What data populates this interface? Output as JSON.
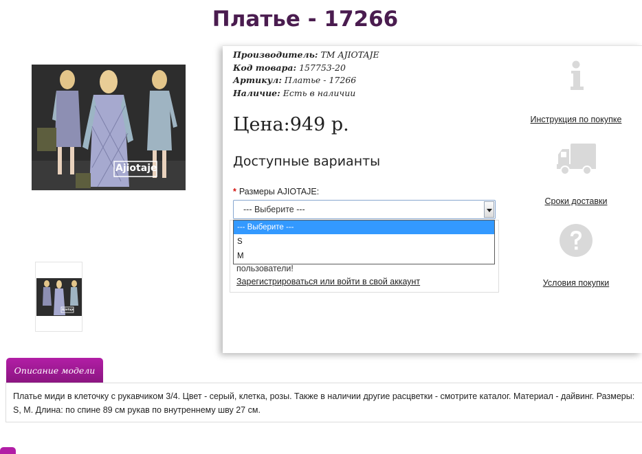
{
  "product": {
    "title": "Платье - 17266",
    "image_caption": "Ajiotaje"
  },
  "meta": {
    "manufacturer_label": "Производитель:",
    "manufacturer_value": "TM AJIOTAJE",
    "code_label": "Код товара:",
    "code_value": "157753-20",
    "article_label": "Артикул:",
    "article_value": "Платье - 17266",
    "availability_label": "Наличие:",
    "availability_value": "Есть в наличии"
  },
  "price": "Цена:949 р.",
  "variants_heading": "Доступные варианты",
  "size": {
    "required_mark": "*",
    "label": "Размеры AJIOTAJE:",
    "selected": "--- Выберите ---",
    "options": [
      "--- Выберите ---",
      "S",
      "M"
    ]
  },
  "login": {
    "text": "пользователи!",
    "link": "Зарегистрироваться или войти в свой аккаунт"
  },
  "sidebar": {
    "instruction": "Инструкция по покупке",
    "delivery": "Сроки доставки",
    "terms": "Условия покупки"
  },
  "tabs": {
    "description": "Описание модели"
  },
  "description": "Платье миди в клеточку с рукавчиком 3/4. Цвет - серый, клетка, розы. Также в наличии другие расцветки - смотрите каталог. Материал - дайвинг. Размеры: S, M. Длина: по спине 89 см рукав по внутреннему шву 27 см.",
  "colors": {
    "title": "#4a1c4f",
    "accent": "#b21ea6",
    "highlight": "#3399ff",
    "icon_gray": "#dadada"
  }
}
